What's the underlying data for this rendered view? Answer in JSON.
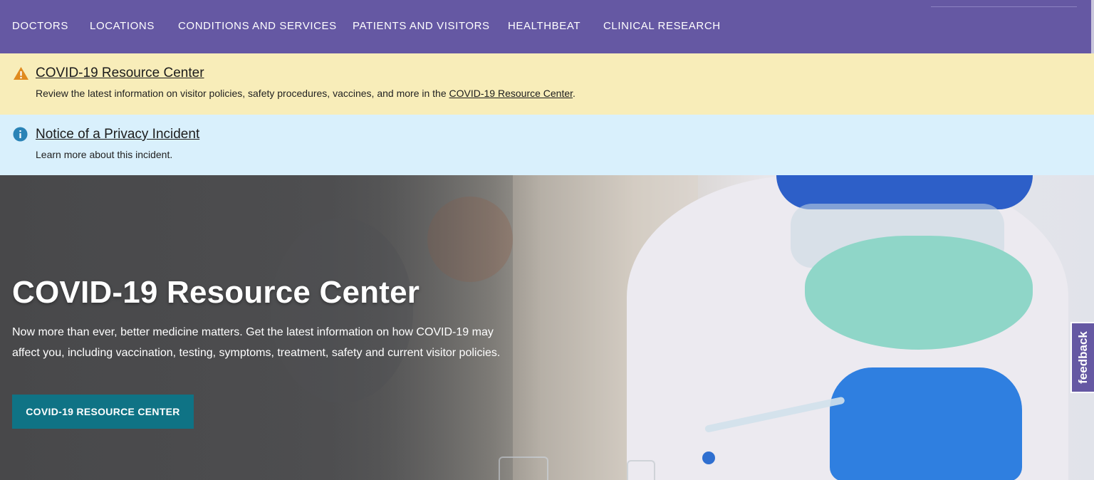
{
  "nav": {
    "items": [
      {
        "label": "DOCTORS"
      },
      {
        "label": "LOCATIONS"
      },
      {
        "label": "CONDITIONS AND SERVICES"
      },
      {
        "label": "PATIENTS AND VISITORS"
      },
      {
        "label": "HEALTHBEAT"
      },
      {
        "label": "CLINICAL RESEARCH"
      }
    ]
  },
  "alerts": {
    "covid": {
      "icon": "warning-icon",
      "title": "COVID-19 Resource Center",
      "body_prefix": "Review the latest information on visitor policies, safety procedures, vaccines, and more in the ",
      "body_link": "COVID-19 Resource Center",
      "body_suffix": "."
    },
    "privacy": {
      "icon": "info-icon",
      "title": "Notice of a Privacy Incident",
      "body": "Learn more about this incident."
    }
  },
  "hero": {
    "title": "COVID-19 Resource Center",
    "text": "Now more than ever, better medicine matters. Get the latest information on how COVID-19 may affect you, including vaccination, testing, symptoms, treatment, safety and current visitor policies.",
    "cta_label": "COVID-19 RESOURCE CENTER"
  },
  "feedback": {
    "label": "feedback"
  },
  "colors": {
    "nav_bg": "#6558a3",
    "covid_alert_bg": "#f8edb9",
    "privacy_alert_bg": "#d9f0fc",
    "cta_bg": "#0f7385",
    "warning": "#e08a1e",
    "info": "#2a83b6"
  }
}
